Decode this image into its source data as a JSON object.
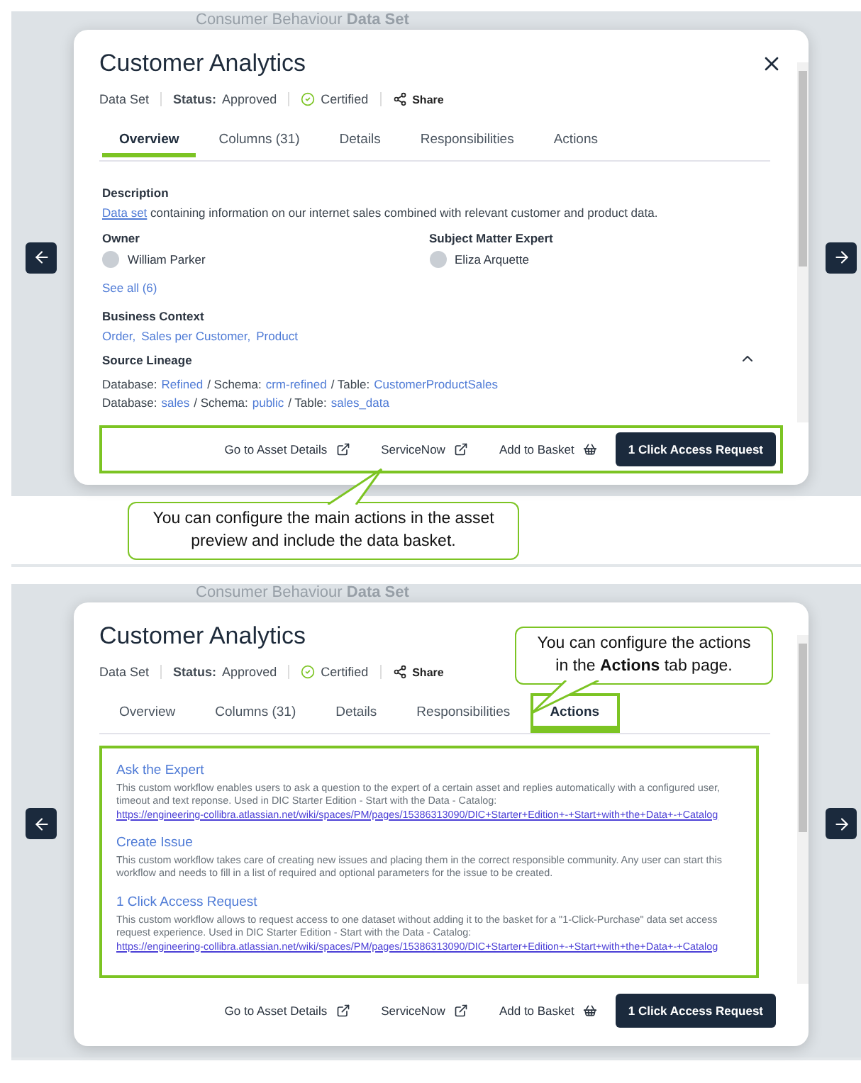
{
  "panels": [
    {
      "background_title": "Consumer Behaviour **Data Set**",
      "modal": {
        "title": "Customer Analytics",
        "type": "Data Set",
        "status": "**Status:** Approved",
        "certified": "Certified",
        "share": "Share",
        "closable": true,
        "tabs": [
          {
            "label": "Overview",
            "selected": true,
            "highlighted": false
          },
          {
            "label": "Columns (31)",
            "selected": false,
            "highlighted": false
          },
          {
            "label": "Details",
            "selected": false,
            "highlighted": false
          },
          {
            "label": "Responsibilities",
            "selected": false,
            "highlighted": false
          },
          {
            "label": "Actions",
            "selected": false,
            "highlighted": false
          }
        ],
        "content": {
          "kind": "overview",
          "highlighted": false,
          "description_heading": "Description",
          "description_link": "Data set",
          "description_text": "containing information on our internet sales combined with relevant customer and product data.",
          "people": [
            {
              "heading": "Owner",
              "name": "William Parker",
              "see_all": "See all (6)"
            },
            {
              "heading": "Subject Matter Expert",
              "name": "Eliza Arquette"
            }
          ],
          "context_heading": "Business Context",
          "context_tags": [
            "Order,",
            "Sales per Customer,",
            "Product"
          ],
          "lineage_heading": "Source Lineage",
          "lineage_expanded": true,
          "lineage_rows": [
            [
              {
                "label": "Database:",
                "value": "Refined"
              },
              {
                "label": "/ Schema:",
                "value": "crm-refined"
              },
              {
                "label": "/ Table:",
                "value": "CustomerProductSales"
              }
            ],
            [
              {
                "label": "Database:",
                "value": "sales"
              },
              {
                "label": "/ Schema:",
                "value": "public"
              },
              {
                "label": "/ Table:",
                "value": "sales_data"
              }
            ]
          ]
        },
        "footer": {
          "highlighted": true,
          "buttons": [
            {
              "kind": "external",
              "label": "Go to Asset Details"
            },
            {
              "kind": "external",
              "label": "ServiceNow"
            },
            {
              "kind": "basket",
              "label": "Add to Basket"
            },
            {
              "kind": "primary",
              "label": "1 Click Access Request"
            }
          ]
        }
      },
      "callout": {
        "kind": "below",
        "text": "You can configure the main actions in the asset preview and include the data basket."
      }
    },
    {
      "background_title": "Consumer Behaviour **Data Set**",
      "modal": {
        "title": "Customer Analytics",
        "type": "Data Set",
        "status": "**Status:** Approved",
        "certified": "Certified",
        "share": "Share",
        "closable": false,
        "tabs": [
          {
            "label": "Overview",
            "selected": false,
            "highlighted": false
          },
          {
            "label": "Columns (31)",
            "selected": false,
            "highlighted": false
          },
          {
            "label": "Details",
            "selected": false,
            "highlighted": false
          },
          {
            "label": "Responsibilities",
            "selected": false,
            "highlighted": false
          },
          {
            "label": "Actions",
            "selected": true,
            "highlighted": true
          }
        ],
        "content": {
          "kind": "actions",
          "highlighted": true,
          "items": [
            {
              "title": "Ask the Expert",
              "text": "This custom workflow enables users to ask a question to the expert of a certain asset and replies automatically with a configured user, timeout and text reponse. Used in DIC Starter Edition - Start with the Data - Catalog:",
              "link": "https://engineering-collibra.atlassian.net/wiki/spaces/PM/pages/15386313090/DIC+Starter+Edition+-+Start+with+the+Data+-+Catalog"
            },
            {
              "title": "Create Issue",
              "text": "This custom workflow takes care of creating new issues and placing them in the correct responsible community. Any user can start this workflow and needs to fill in a list of required and optional parameters for the issue to be created."
            },
            {
              "title": "1 Click Access Request",
              "text": "This custom workflow allows to request access to one dataset without adding it to the basket for a \"1-Click-Purchase\" data set access request experience. Used in DIC Starter Edition - Start with the Data - Catalog:",
              "link": "https://engineering-collibra.atlassian.net/wiki/spaces/PM/pages/15386313090/DIC+Starter+Edition+-+Start+with+the+Data+-+Catalog"
            }
          ]
        },
        "footer": {
          "highlighted": false,
          "buttons": [
            {
              "kind": "external",
              "label": "Go to Asset Details"
            },
            {
              "kind": "external",
              "label": "ServiceNow"
            },
            {
              "kind": "basket",
              "label": "Add to Basket"
            },
            {
              "kind": "primary",
              "label": "1 Click Access Request"
            }
          ]
        }
      },
      "callout": {
        "kind": "corner",
        "text": "You can configure the actions in the **Actions** tab page."
      }
    }
  ]
}
